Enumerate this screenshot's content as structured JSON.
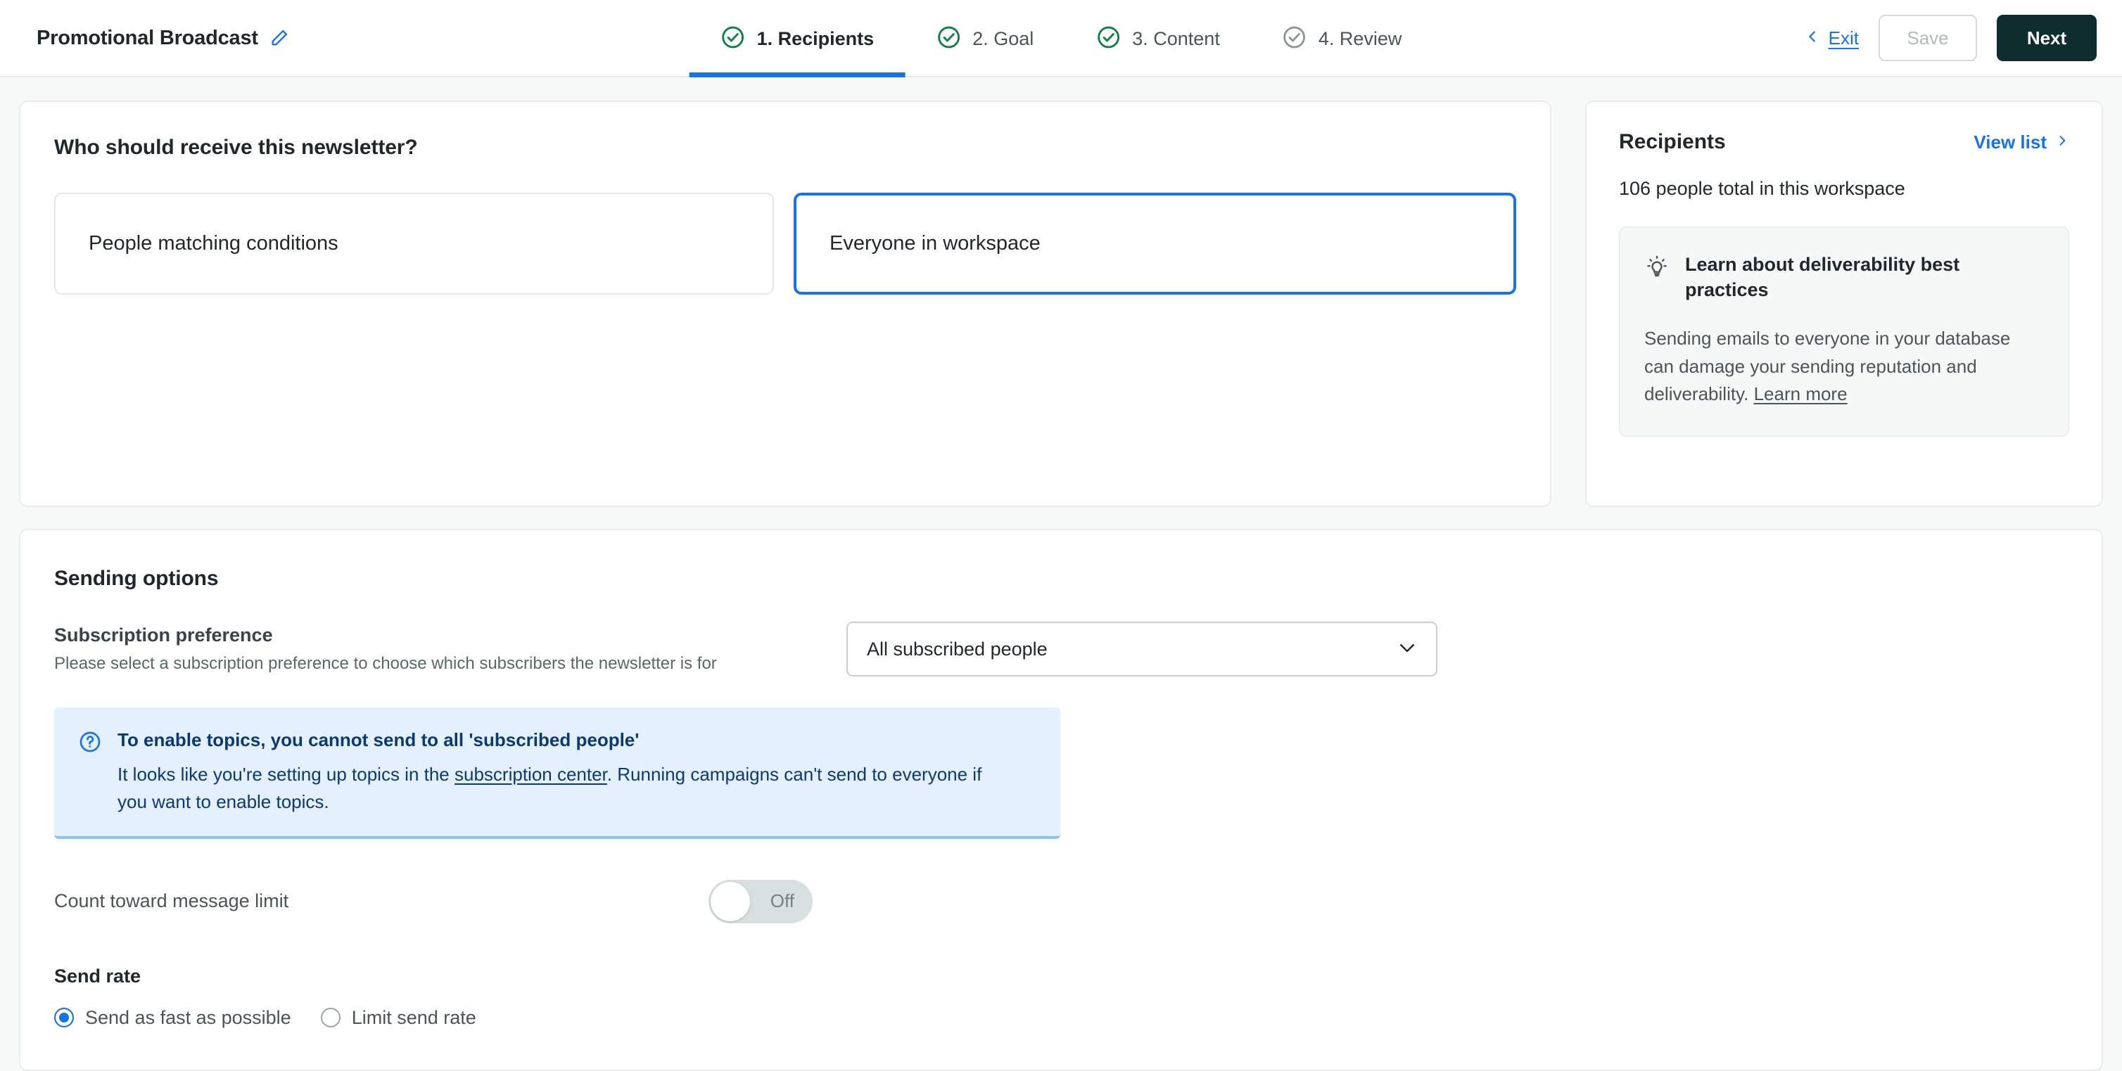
{
  "header": {
    "title": "Promotional Broadcast",
    "edit_icon": "pencil-icon",
    "steps": [
      {
        "label": "1. Recipients",
        "state": "complete",
        "active": true
      },
      {
        "label": "2. Goal",
        "state": "complete",
        "active": false
      },
      {
        "label": "3. Content",
        "state": "complete",
        "active": false
      },
      {
        "label": "4. Review",
        "state": "pending",
        "active": false
      }
    ],
    "exit_label": "Exit",
    "save_label": "Save",
    "next_label": "Next"
  },
  "recipients_section": {
    "heading": "Who should receive this newsletter?",
    "choices": [
      {
        "label": "People matching conditions",
        "selected": false
      },
      {
        "label": "Everyone in workspace",
        "selected": true
      }
    ]
  },
  "side_panel": {
    "title": "Recipients",
    "view_list_label": "View list",
    "count_text": "106 people total in this workspace",
    "tip": {
      "icon": "lightbulb-icon",
      "title": "Learn about deliverability best practices",
      "body_before": "Sending emails to everyone in your database can damage your sending reputation and deliverability. ",
      "link_label": "Learn more"
    }
  },
  "sending_options": {
    "heading": "Sending options",
    "subscription_preference": {
      "label": "Subscription preference",
      "help": "Please select a subscription preference to choose which subscribers the newsletter is for",
      "selected_value": "All subscribed people"
    },
    "banner": {
      "icon": "question-circle-icon",
      "title": "To enable topics, you cannot send to all 'subscribed people'",
      "text_before": "It looks like you're setting up topics in the ",
      "link_label": "subscription center",
      "text_after": ". Running campaigns can't send to everyone if you want to enable topics."
    },
    "message_limit": {
      "label": "Count toward message limit",
      "state_label": "Off",
      "on": false
    },
    "send_rate": {
      "label": "Send rate",
      "options": [
        {
          "label": "Send as fast as possible",
          "checked": true
        },
        {
          "label": "Limit send rate",
          "checked": false
        }
      ]
    }
  },
  "colors": {
    "accent_blue": "#1773e6",
    "complete_green": "#0a8043",
    "pending_gray": "#8b9596",
    "next_button_bg": "#0f2c2e",
    "banner_bg": "#e4f0fd",
    "banner_text": "#0b3a73"
  }
}
